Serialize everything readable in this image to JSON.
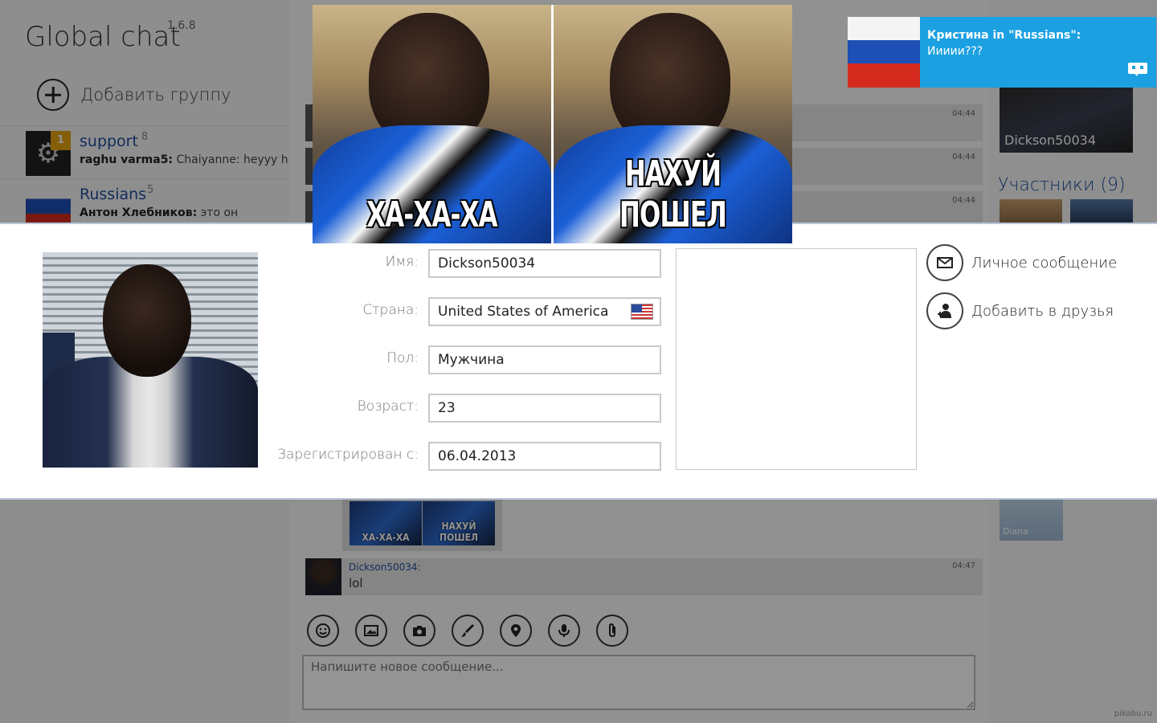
{
  "app": {
    "title": "Global chat",
    "version": "1.6.8",
    "add_group_label": "Добавить группу"
  },
  "groups": [
    {
      "name": "support",
      "count": "8",
      "badge": "1",
      "last_author": "raghu varma5:",
      "last_text": " Chaiyanne: heyyy hiii",
      "icon": "gear-icon"
    },
    {
      "name": "Russians",
      "count": "5",
      "last_author": "Антон Хлебников:",
      "last_text": " это он",
      "icon": "russia-flag"
    }
  ],
  "messages": [
    {
      "time": "04:44"
    },
    {
      "time": "04:44"
    },
    {
      "time": "04:44"
    }
  ],
  "image_popup": {
    "left_caption": "ХА-ХА-ХА",
    "right_caption": "НАХУЙ ПОШЕЛ"
  },
  "thumbnail": {
    "left_caption": "ХА-ХА-ХА",
    "right_caption": "НАХУЙ ПОШЕЛ"
  },
  "last_message": {
    "author": "Dickson50034:",
    "text": "lol",
    "time": "04:47"
  },
  "composer": {
    "placeholder": "Напишите новое сообщение..."
  },
  "toolbar_icons": [
    "smile-icon",
    "image-icon",
    "camera-icon",
    "brush-icon",
    "location-pin-icon",
    "microphone-icon",
    "paperclip-icon"
  ],
  "right_column": {
    "profile_name": "Dickson50034",
    "members_title": "Участники (9)",
    "member_diana": "Diana"
  },
  "notification": {
    "title": "Кристина in \"Russians\":",
    "body": "Иииии???",
    "accent": "#1ba1e2"
  },
  "profile": {
    "fields": [
      {
        "label": "Имя:",
        "value": "Dickson50034"
      },
      {
        "label": "Страна:",
        "value": "United States of America"
      },
      {
        "label": "Пол:",
        "value": "Мужчина"
      },
      {
        "label": "Возраст:",
        "value": "23"
      },
      {
        "label": "Зарегистрирован с:",
        "value": "06.04.2013"
      }
    ],
    "actions": {
      "message_label": "Личное сообщение",
      "add_friend_label": "Добавить в друзья"
    }
  },
  "watermark": "pikabu.ru"
}
